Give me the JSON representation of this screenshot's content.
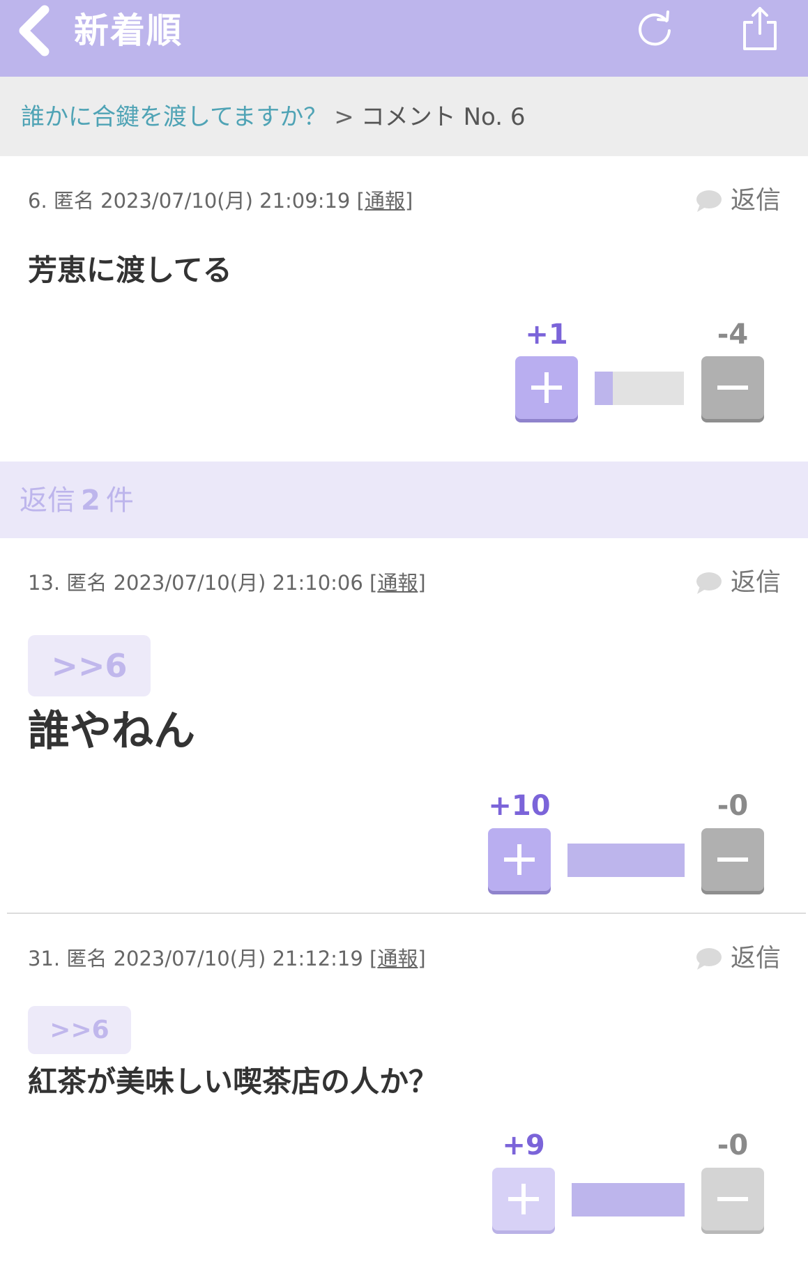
{
  "header": {
    "title": "新着順",
    "back_icon": "chevron-left-icon",
    "reload_icon": "reload-icon",
    "share_icon": "share-icon",
    "background_color": "#bdb5ec"
  },
  "breadcrumb": {
    "topic": "誰かに合鍵を渡してますか？",
    "separator": ">",
    "current": "コメント No. 6"
  },
  "reply_section": {
    "prefix": "返信",
    "count": "2",
    "suffix": "件"
  },
  "comments": [
    {
      "number": "6.",
      "author": "匿名",
      "datetime": "2023/07/10(月) 21:09:19",
      "report_label": "通報",
      "reply_label": "返信",
      "anchor": "",
      "text": "芳恵に渡してる",
      "plus": "+1",
      "minus": "-4",
      "plus_ratio": 0.2
    },
    {
      "number": "13.",
      "author": "匿名",
      "datetime": "2023/07/10(月) 21:10:06",
      "report_label": "通報",
      "reply_label": "返信",
      "anchor": ">>6",
      "text": "誰やねん",
      "plus": "+10",
      "minus": "-0",
      "plus_ratio": 1.0
    },
    {
      "number": "31.",
      "author": "匿名",
      "datetime": "2023/07/10(月) 21:12:19",
      "report_label": "通報",
      "reply_label": "返信",
      "anchor": ">>6",
      "text": "紅茶が美味しい喫茶店の人か？",
      "plus": "+9",
      "minus": "-0",
      "plus_ratio": 1.0
    }
  ]
}
